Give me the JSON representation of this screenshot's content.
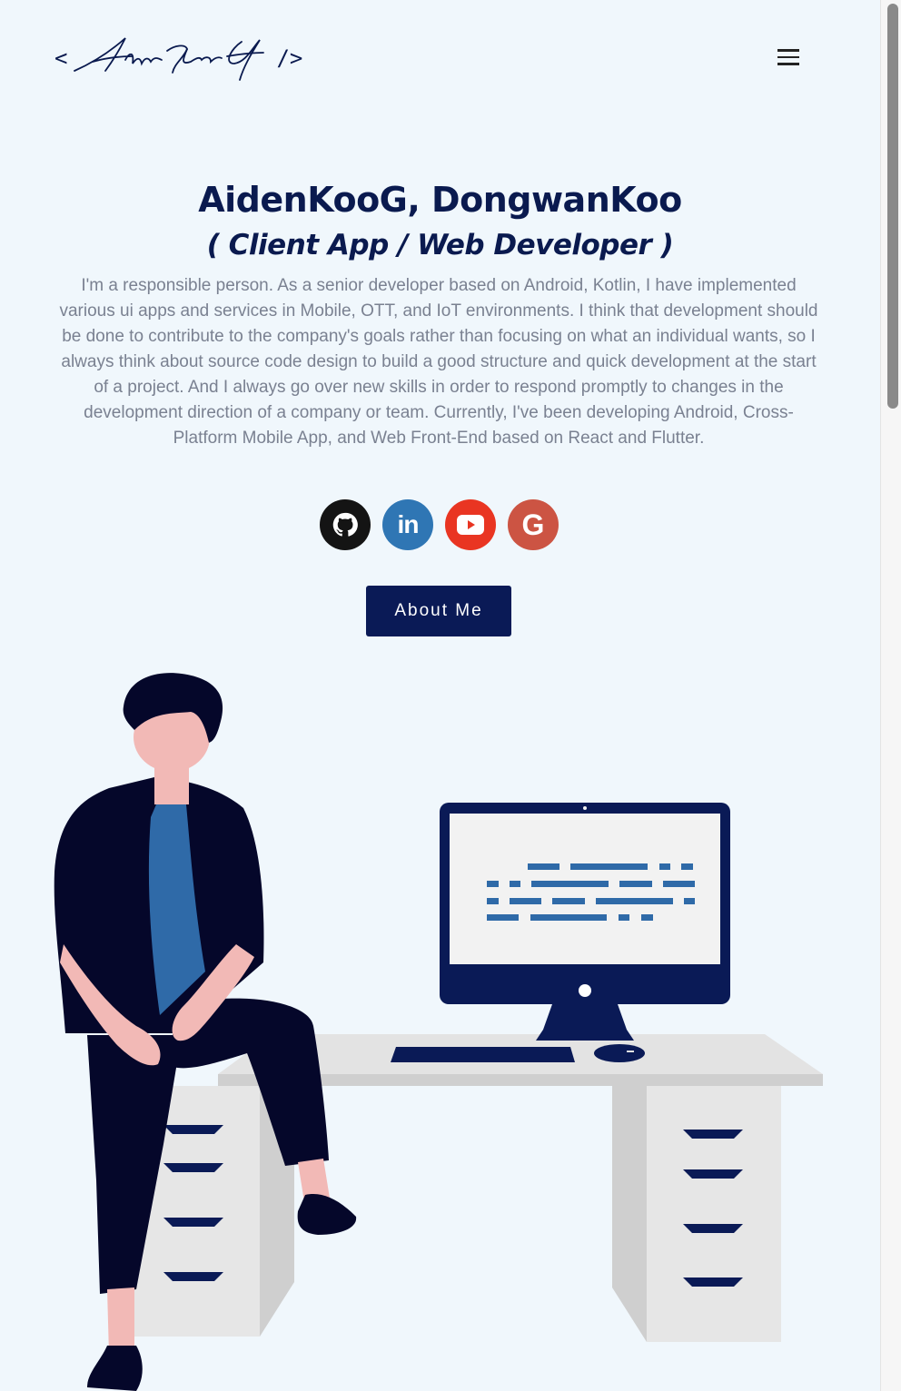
{
  "header": {
    "logo_prefix": "<",
    "logo_suffix": "/>",
    "logo_signature": "AidenKooG",
    "menu_icon": "hamburger-menu-icon"
  },
  "hero": {
    "name": "AidenKooG, DongwanKoo",
    "role": "( Client App / Web Developer )",
    "bio": "I'm a responsible person. As a senior developer based on Android, Kotlin, I have implemented various ui apps and services in Mobile, OTT, and IoT environments. I think that development should be done to contribute to the company's goals rather than focusing on what an individual wants, so I always think about source code design to build a good structure and quick development at the start of a project. And I always go over new skills in order to respond promptly to changes in the development direction of a company or team. Currently, I've been developing Android, Cross-Platform Mobile App, and Web Front-End based on React and Flutter.",
    "socials": [
      {
        "name": "github",
        "icon": "github-icon",
        "color": "#141414"
      },
      {
        "name": "linkedin",
        "icon": "linkedin-icon",
        "label": "in",
        "color": "#2f76b4"
      },
      {
        "name": "youtube",
        "icon": "youtube-icon",
        "color": "#e93522"
      },
      {
        "name": "google",
        "icon": "google-icon",
        "label": "G",
        "color": "#cc5443"
      }
    ],
    "about_button": "About Me"
  },
  "colors": {
    "background": "#f0f7fc",
    "navy": "#0a1a56",
    "accent_blue": "#2f6aa8",
    "skin": "#f2b9b6",
    "desk_grey": "#e3e3e3"
  }
}
